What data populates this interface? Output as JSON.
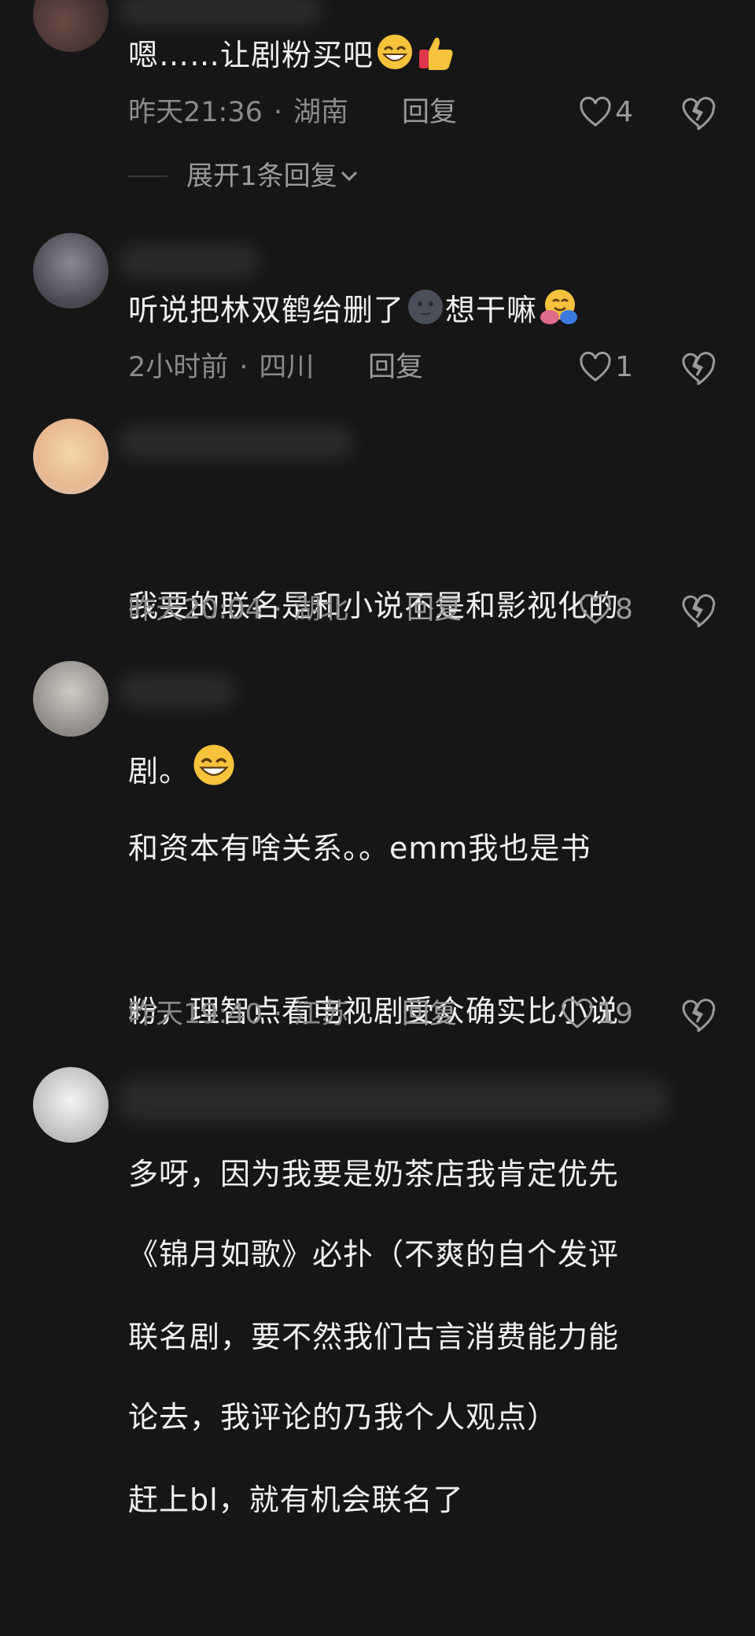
{
  "comments": [
    {
      "text": "嗯……让剧粉买吧",
      "time": "昨天21:36",
      "location": "湖南",
      "reply_label": "回复",
      "likes": "4",
      "expand_label": "展开1条回复"
    },
    {
      "text": "听说把林双鹤给删了",
      "text_after_emoji": "想干嘛",
      "time": "2小时前",
      "location": "四川",
      "reply_label": "回复",
      "likes": "1"
    },
    {
      "text_line1": "我要的联名是和小说不是和影视化的",
      "text_line2": "剧。",
      "time": "昨天20:04",
      "location": "湖北",
      "reply_label": "回复",
      "likes": "8"
    },
    {
      "lines": [
        "和资本有啥关系。。emm我也是书",
        "粉，理智点看电视剧受众确实比小说",
        "多呀，因为我要是奶茶店我肯定优先",
        "联名剧，要不然我们古言消费能力能",
        "赶上bl，就有机会联名了"
      ],
      "time": "昨天19:40",
      "location": "江苏",
      "reply_label": "回复",
      "likes": "19"
    },
    {
      "lines": [
        "《锦月如歌》必扑（不爽的自个发评",
        "论去，我评论的乃我个人观点）"
      ]
    }
  ],
  "colors": {
    "background": "#161616",
    "text": "#f0f0f0",
    "meta": "#8a8a8a"
  },
  "icons": [
    "heart-outline-icon",
    "broken-heart-icon",
    "chevron-down-icon",
    "grinning-emoji",
    "thumbs-up-emoji",
    "new-moon-face-emoji",
    "hugging-face-emoji"
  ]
}
